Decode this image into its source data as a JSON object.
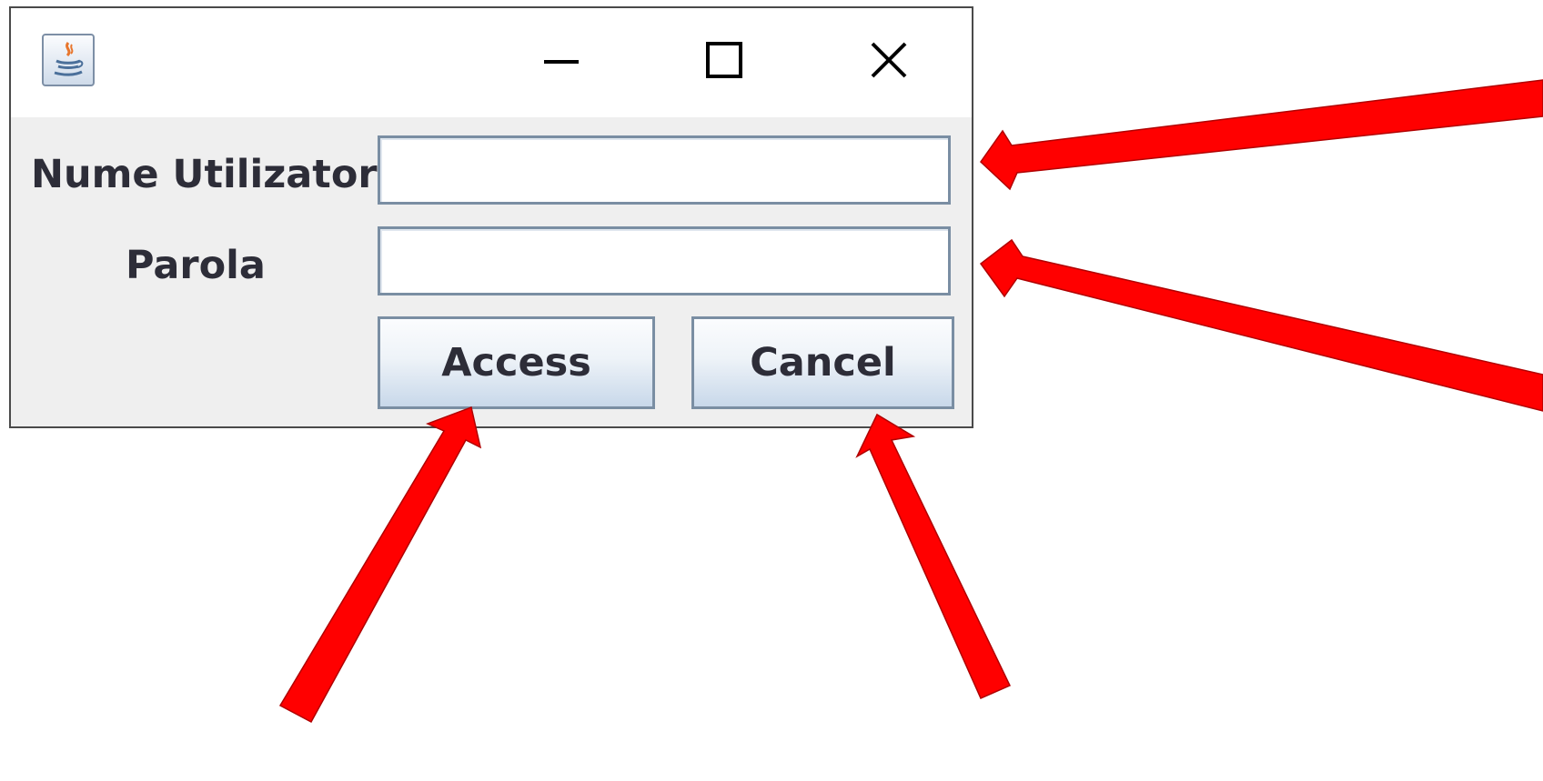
{
  "window": {
    "title": "",
    "controls": {
      "minimize_icon": "minimize-icon",
      "maximize_icon": "maximize-icon",
      "close_icon": "close-icon"
    },
    "app_icon": "java-app-icon"
  },
  "form": {
    "username_label": "Nume Utilizator",
    "username_value": "",
    "password_label": "Parola",
    "password_value": "",
    "access_label": "Access",
    "cancel_label": "Cancel"
  },
  "annotations": {
    "arrow_color": "#ff0000",
    "arrow_count": 4
  }
}
